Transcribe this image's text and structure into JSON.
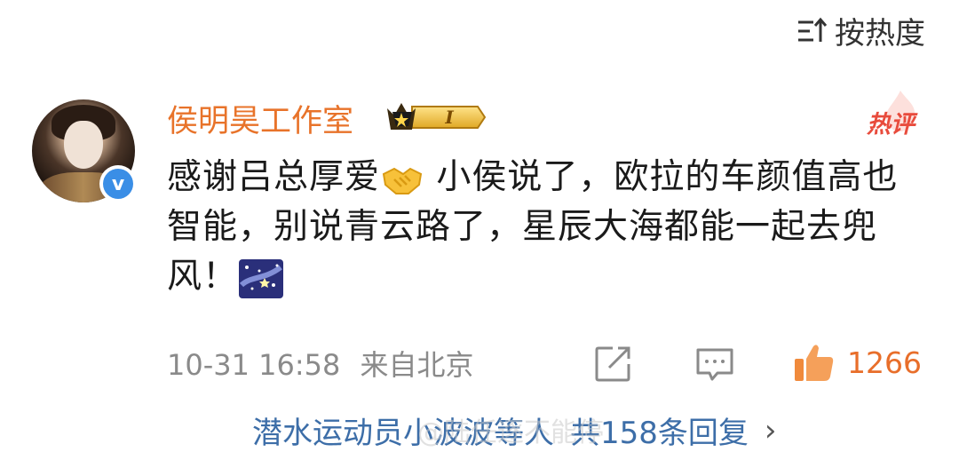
{
  "sort": {
    "label": "按热度",
    "icon": "sort-icon"
  },
  "comment": {
    "username": "侯明昊工作室",
    "badge_level": "I",
    "hot_tag": "热评",
    "content_part1": "感谢吕总厚爱",
    "content_part2": " 小侯说了，欧拉的车颜值高也智能，别说青云路了，星辰大海都能一起去兜风！",
    "emojis": [
      "handshake-emoji",
      "starry-sky-emoji"
    ],
    "date": "10-31 16:58",
    "location": "来自北京",
    "like_count": "1266"
  },
  "replies": {
    "text": "潜水运动员小波波等人",
    "count_text": "共158条回复",
    "chevron": "›"
  },
  "watermark": "@陆任逐不能停",
  "colors": {
    "username": "#e8732a",
    "link": "#3d6ea8",
    "meta": "#8a8a8a",
    "like": "#e86e2a",
    "hot": "#e84b3c",
    "verified": "#3a8ee6"
  }
}
